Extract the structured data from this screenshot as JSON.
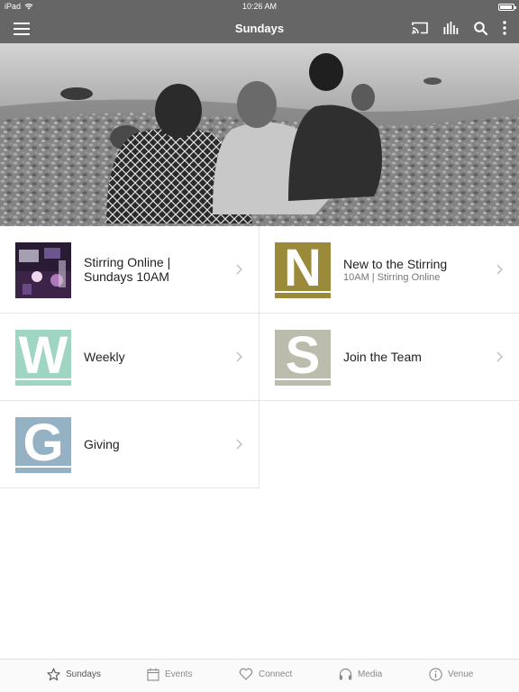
{
  "status_bar": {
    "carrier": "iPad",
    "time": "10:26 AM"
  },
  "app_bar": {
    "title": "Sundays"
  },
  "grid": [
    {
      "label": "Stirring Online |\nSundays 10AM",
      "label_line1": "Stirring Online |",
      "label_line2": "Sundays 10AM",
      "thumb": "photo"
    },
    {
      "label": "New to the Stirring",
      "sublabel": "10AM | Stirring Online",
      "letter": "N",
      "color": "#9b8a3a"
    },
    {
      "label": "Weekly",
      "letter": "W",
      "color": "#9fd5c3"
    },
    {
      "label": "Join the Team",
      "letter": "S",
      "color": "#bcbcac"
    },
    {
      "label": "Giving",
      "letter": "G",
      "color": "#95b2c4"
    }
  ],
  "tabs": [
    {
      "label": "Sundays",
      "icon": "star-icon"
    },
    {
      "label": "Events",
      "icon": "calendar-icon"
    },
    {
      "label": "Connect",
      "icon": "heart-icon"
    },
    {
      "label": "Media",
      "icon": "headphones-icon"
    },
    {
      "label": "Venue",
      "icon": "info-icon"
    }
  ]
}
